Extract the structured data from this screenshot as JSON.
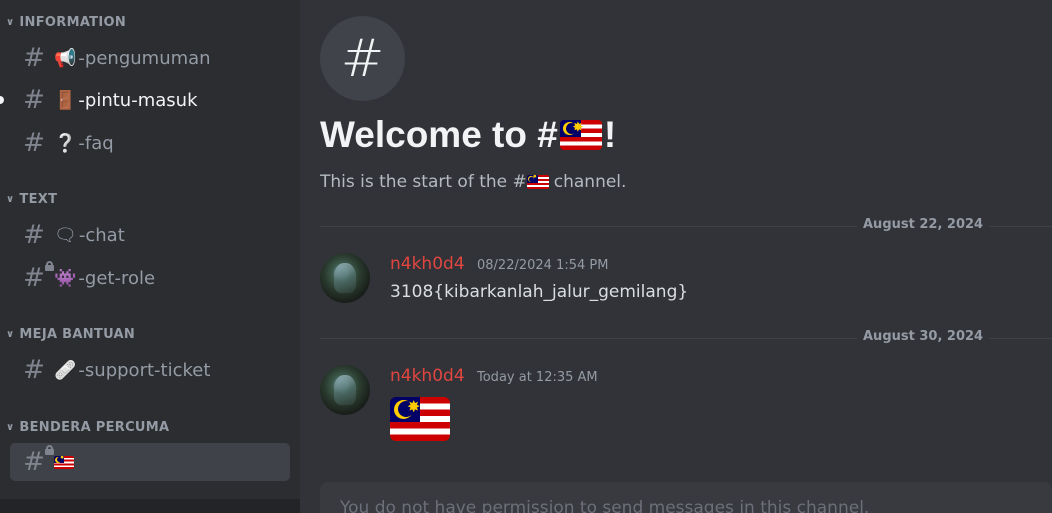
{
  "sidebar": {
    "categories": [
      {
        "label": "INFORMATION",
        "channels": [
          {
            "emoji": "📢",
            "name": "-pengumuman",
            "icon": "megaphone-icon"
          },
          {
            "emoji": "🚪",
            "name": "-pintu-masuk",
            "icon": "door-icon",
            "unread": true
          },
          {
            "emoji": "❔",
            "name": "-faq",
            "icon": "question-icon"
          }
        ]
      },
      {
        "label": "TEXT",
        "channels": [
          {
            "emoji": "🗨",
            "name": "-chat",
            "icon": "speech-bubble-icon"
          },
          {
            "emoji": "👾",
            "name": "-get-role",
            "icon": "alien-monster-icon",
            "locked": true
          }
        ]
      },
      {
        "label": "MEJA BANTUAN",
        "channels": [
          {
            "emoji": "🩹",
            "name": "-support-ticket",
            "icon": "bandage-icon"
          }
        ]
      },
      {
        "label": "BENDERA PERCUMA",
        "channels": [
          {
            "emoji": "🇲🇾",
            "name": "",
            "icon": "malaysia-flag-icon",
            "locked": true,
            "selected": true
          }
        ]
      }
    ]
  },
  "main": {
    "hash_symbol": "#",
    "welcome_prefix": "Welcome to #",
    "welcome_suffix": "!",
    "start_prefix": "This is the start of the #",
    "start_suffix": "channel.",
    "dividers": [
      "August 22, 2024",
      "August 30, 2024"
    ],
    "messages": [
      {
        "author": "n4kh0d4",
        "timestamp": "08/22/2024 1:54 PM",
        "text": "3108{kibarkanlah_jalur_gemilang}"
      },
      {
        "author": "n4kh0d4",
        "timestamp": "Today at 12:35 AM",
        "text": "",
        "emoji": "malaysia-flag-icon"
      }
    ],
    "input_placeholder": "You do not have permission to send messages in this channel."
  },
  "colors": {
    "sidebar_bg": "#2b2d31",
    "main_bg": "#313338",
    "author": "#e0463f",
    "selected_bg": "#404249"
  }
}
